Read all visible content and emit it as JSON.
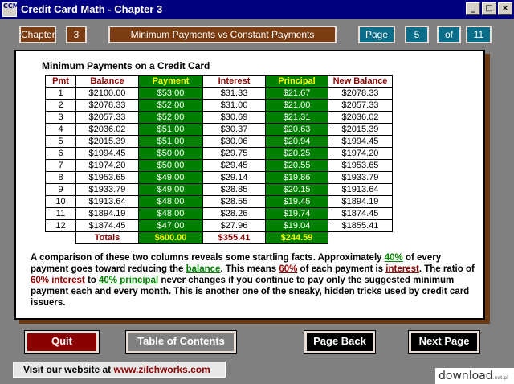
{
  "window": {
    "title": "Credit Card Math - Chapter 3",
    "icon_text": "CCM",
    "controls": [
      "_",
      "□",
      "×"
    ]
  },
  "nav": {
    "chapter_label": "Chapter",
    "chapter_number": "3",
    "chapter_title": "Minimum Payments vs Constant Payments",
    "page_label": "Page",
    "page_number": "5",
    "of_label": "of",
    "page_total": "11"
  },
  "table": {
    "title": "Minimum Payments on a Credit Card",
    "headers": [
      "Pmt",
      "Balance",
      "Payment",
      "Interest",
      "Principal",
      "New Balance"
    ],
    "rows": [
      [
        "1",
        "$2100.00",
        "$53.00",
        "$31.33",
        "$21.67",
        "$2078.33"
      ],
      [
        "2",
        "$2078.33",
        "$52.00",
        "$31.00",
        "$21.00",
        "$2057.33"
      ],
      [
        "3",
        "$2057.33",
        "$52.00",
        "$30.69",
        "$21.31",
        "$2036.02"
      ],
      [
        "4",
        "$2036.02",
        "$51.00",
        "$30.37",
        "$20.63",
        "$2015.39"
      ],
      [
        "5",
        "$2015.39",
        "$51.00",
        "$30.06",
        "$20.94",
        "$1994.45"
      ],
      [
        "6",
        "$1994.45",
        "$50.00",
        "$29.75",
        "$20.25",
        "$1974.20"
      ],
      [
        "7",
        "$1974.20",
        "$50.00",
        "$29.45",
        "$20.55",
        "$1953.65"
      ],
      [
        "8",
        "$1953.65",
        "$49.00",
        "$29.14",
        "$19.86",
        "$1933.79"
      ],
      [
        "9",
        "$1933.79",
        "$49.00",
        "$28.85",
        "$20.15",
        "$1913.64"
      ],
      [
        "10",
        "$1913.64",
        "$48.00",
        "$28.55",
        "$19.45",
        "$1894.19"
      ],
      [
        "11",
        "$1894.19",
        "$48.00",
        "$28.26",
        "$19.74",
        "$1874.45"
      ],
      [
        "12",
        "$1874.45",
        "$47.00",
        "$27.96",
        "$19.04",
        "$1855.41"
      ]
    ],
    "totals": {
      "label": "Totals",
      "payment": "$600.00",
      "interest": "$355.41",
      "principal": "$244.59"
    }
  },
  "paragraph": {
    "s1": "A comparison of these two columns reveals some startling facts.  Approximately ",
    "h1": "40%",
    "s2": " of every payment goes toward reducing the ",
    "h2": "balance",
    "s3": ".  This means ",
    "h3": "60%",
    "s4": " of each payment is ",
    "h4": "interest",
    "s5": ".  The ratio of ",
    "h5": "60% interest",
    "s6": " to ",
    "h6": "40% principal",
    "s7": "  never changes if you continue to pay only the suggested minimum payment each and every month.  This is another one of the sneaky, hidden tricks used by credit card issuers."
  },
  "buttons": {
    "quit": "Quit",
    "toc": "Table of Contents",
    "back": "Page Back",
    "next": "Next Page"
  },
  "footer": {
    "website_prefix": "Visit our website at ",
    "website_url": "www.zilchworks.com"
  },
  "watermark": {
    "text": "download",
    "suffix": ".net.pl"
  },
  "colors": {
    "title_bar": "#000080",
    "brown": "#7a3c10",
    "teal": "#0a6e8a",
    "green": "#008000",
    "dark_red": "#8b0000"
  }
}
